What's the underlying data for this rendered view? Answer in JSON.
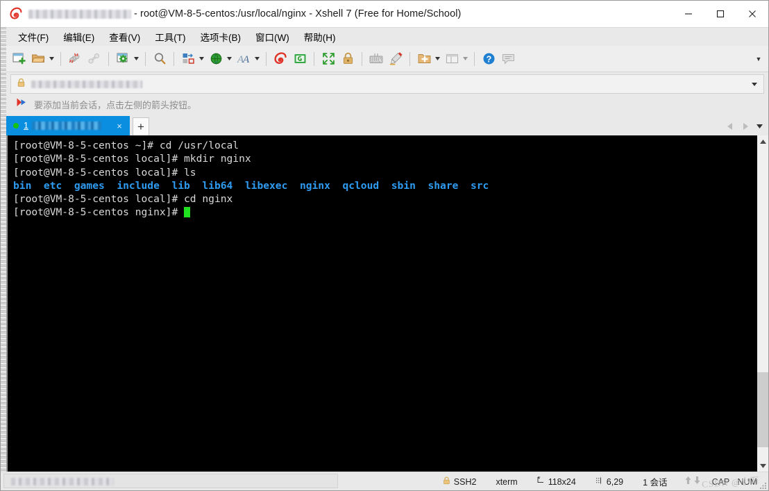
{
  "window": {
    "title_redacted": true,
    "title": "- root@VM-8-5-centos:/usr/local/nginx - Xshell 7 (Free for Home/School)",
    "logo_icon": "xshell-shell-icon",
    "minimize_label": "─",
    "maximize_label": "□",
    "close_label": "×"
  },
  "menubar": {
    "items": [
      {
        "label": "文件(F)",
        "name": "menu-file"
      },
      {
        "label": "编辑(E)",
        "name": "menu-edit"
      },
      {
        "label": "查看(V)",
        "name": "menu-view"
      },
      {
        "label": "工具(T)",
        "name": "menu-tools"
      },
      {
        "label": "选项卡(B)",
        "name": "menu-tabs"
      },
      {
        "label": "窗口(W)",
        "name": "menu-window"
      },
      {
        "label": "帮助(H)",
        "name": "menu-help"
      }
    ]
  },
  "toolbar": {
    "buttons": [
      {
        "icon": "new-session-icon",
        "name": "new-session-button",
        "caret": false
      },
      {
        "icon": "open-folder-icon",
        "name": "open-session-button",
        "caret": true
      },
      {
        "icon": "disconnect-icon",
        "name": "disconnect-button",
        "caret": false
      },
      {
        "icon": "reconnect-icon",
        "name": "reconnect-button",
        "caret": false
      },
      {
        "icon": "session-properties-icon",
        "name": "properties-button",
        "caret": true
      },
      {
        "icon": "find-icon",
        "name": "find-button",
        "caret": false
      },
      {
        "icon": "transfer-icon",
        "name": "file-transfer-button",
        "caret": true
      },
      {
        "icon": "globe-icon",
        "name": "tunneling-button",
        "caret": true
      },
      {
        "icon": "font-icon",
        "name": "font-button",
        "caret": true
      },
      {
        "icon": "xshell-icon",
        "name": "new-xshell-button",
        "caret": false
      },
      {
        "icon": "xftp-icon",
        "name": "new-xftp-button",
        "caret": false
      },
      {
        "icon": "fullscreen-icon",
        "name": "fullscreen-button",
        "caret": false
      },
      {
        "icon": "lock-icon",
        "name": "lock-button",
        "caret": false
      },
      {
        "icon": "keyboard-icon",
        "name": "compose-bar-button",
        "caret": false
      },
      {
        "icon": "highlight-pen-icon",
        "name": "highlight-button",
        "caret": false
      },
      {
        "icon": "add-to-folder-icon",
        "name": "add-session-button",
        "caret": true
      },
      {
        "icon": "layout-icon",
        "name": "arrange-layout-button",
        "caret": true
      },
      {
        "icon": "help-icon",
        "name": "help-button",
        "caret": false
      },
      {
        "icon": "chat-icon",
        "name": "feedback-button",
        "caret": false
      }
    ],
    "overflow_label": "▼"
  },
  "addressbar": {
    "lock_icon": "lock-icon",
    "value_redacted": true,
    "placeholder": "",
    "dropdown_label": "▼"
  },
  "notification": {
    "icon": "arrow-flag-icon",
    "text": "要添加当前会话，点击左侧的箭头按钮。"
  },
  "tabbar": {
    "tabs": [
      {
        "status_icon": "connected-dot-icon",
        "index_label": "1",
        "title_redacted": true,
        "close_label": "×",
        "active": true
      }
    ],
    "add_tab_label": "+",
    "nav_prev_label": "◀",
    "nav_next_label": "▶",
    "nav_list_label": "▼"
  },
  "terminal": {
    "lines": [
      {
        "segments": [
          {
            "text": "[root@VM-8-5-centos ~]# cd /usr/local",
            "style": "normal"
          }
        ]
      },
      {
        "segments": [
          {
            "text": "[root@VM-8-5-centos local]# mkdir nginx",
            "style": "normal"
          }
        ]
      },
      {
        "segments": [
          {
            "text": "[root@VM-8-5-centos local]# ls",
            "style": "normal"
          }
        ]
      },
      {
        "segments": [
          {
            "text": "bin  etc  games  include  lib  lib64  libexec  nginx  qcloud  sbin  share  src",
            "style": "dir"
          }
        ]
      },
      {
        "segments": [
          {
            "text": "[root@VM-8-5-centos local]# cd nginx",
            "style": "normal"
          }
        ]
      },
      {
        "segments": [
          {
            "text": "[root@VM-8-5-centos nginx]# ",
            "style": "normal"
          },
          {
            "text": "",
            "style": "cursor"
          }
        ]
      }
    ],
    "background": "#000000",
    "foreground": "#d9d9d9",
    "dir_color": "#2e9bf0",
    "cursor_color": "#1fe11f"
  },
  "scrollbar": {
    "up_label": "▲",
    "down_label": "▼",
    "thumb_top_pct": 72,
    "thumb_height_pct": 24
  },
  "statusbar": {
    "left_redacted": true,
    "protocol_icon": "lock-icon",
    "protocol": "SSH2",
    "terminal_type": "xterm",
    "size_icon": "resize-icon",
    "size": "118x24",
    "cursor_icon": "cursor-pos-icon",
    "cursor_pos": "6,29",
    "sessions": "1 会话",
    "up_arrow": "↑",
    "down_arrow": "↓",
    "caps": "CAP",
    "num": "NUM",
    "watermark": "CSDN @小万"
  }
}
